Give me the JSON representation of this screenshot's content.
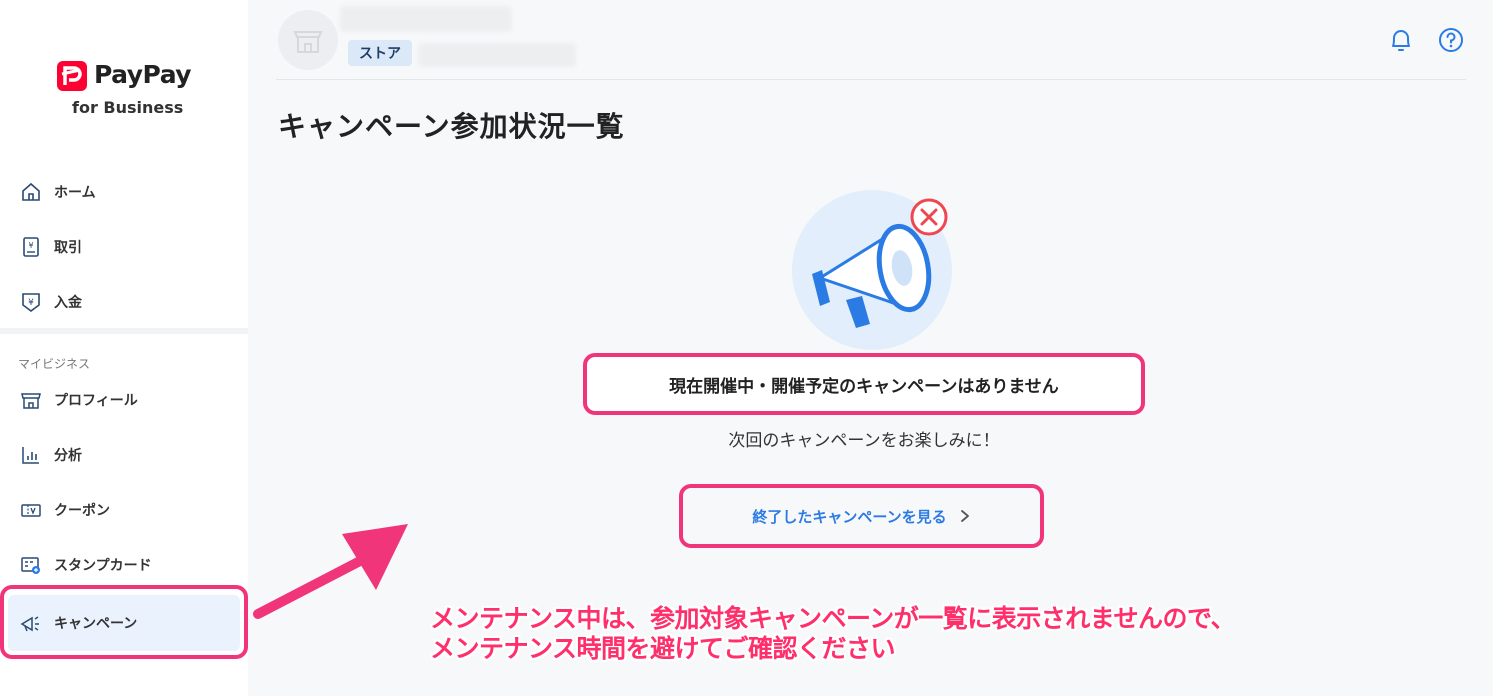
{
  "brand": {
    "name": "PayPay",
    "sub": "for Business",
    "color": "#ff0033"
  },
  "sidebar": {
    "items": [
      {
        "label": "ホーム",
        "icon": "home-icon"
      },
      {
        "label": "取引",
        "icon": "receipt-icon"
      },
      {
        "label": "入金",
        "icon": "deposit-icon"
      }
    ],
    "section_label": "マイビジネス",
    "biz_items": [
      {
        "label": "プロフィール",
        "icon": "store-icon"
      },
      {
        "label": "分析",
        "icon": "chart-icon"
      },
      {
        "label": "クーポン",
        "icon": "coupon-icon"
      },
      {
        "label": "スタンプカード",
        "icon": "stamp-card-icon"
      },
      {
        "label": "キャンペーン",
        "icon": "megaphone-icon",
        "active": true
      }
    ]
  },
  "header": {
    "store_tag": "ストア"
  },
  "page": {
    "title": "キャンペーン参加状況一覧",
    "empty_title": "現在開催中・開催予定のキャンペーンはありません",
    "empty_sub": "次回のキャンペーンをお楽しみに！",
    "ended_link": "終了したキャンペーンを見る"
  },
  "annotation": {
    "line1": "メンテナンス中は、参加対象キャンペーンが一覧に表示されませんので、",
    "line2": "メンテナンス時間を避けてご確認ください",
    "color": "#ff2f6b"
  },
  "colors": {
    "accent": "#2b7be4",
    "highlight": "#f0357a",
    "active_bg": "#eaf3fd"
  }
}
